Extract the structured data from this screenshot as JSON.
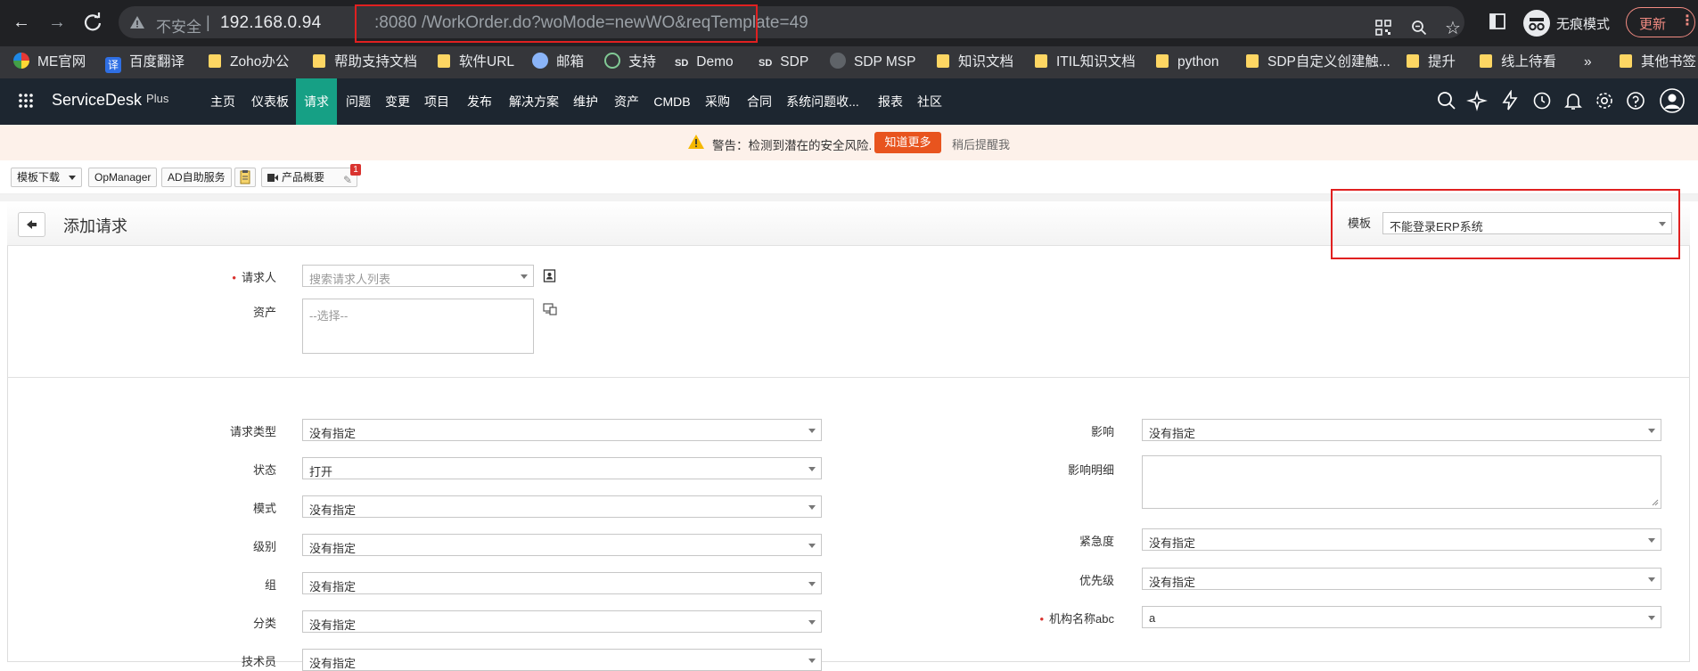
{
  "browser": {
    "insecure_label": "不安全",
    "separator": "|",
    "url_host": "192.168.0.94",
    "url_port": ":8080",
    "url_path": "/WorkOrder.do?woMode=newWO&reqTemplate=49",
    "incognito_label": "无痕模式",
    "update_label": "更新"
  },
  "bookmarks": [
    {
      "label": "ME官网",
      "icon": "me-logo-icon"
    },
    {
      "label": "百度翻译",
      "icon": "translate-icon"
    },
    {
      "label": "Zoho办公",
      "icon": "folder-icon"
    },
    {
      "label": "帮助支持文档",
      "icon": "folder-icon"
    },
    {
      "label": "软件URL",
      "icon": "folder-icon"
    },
    {
      "label": "邮箱",
      "icon": "mail-icon"
    },
    {
      "label": "支持",
      "icon": "support-icon"
    },
    {
      "label": "Demo",
      "icon": "sd-icon"
    },
    {
      "label": "SDP",
      "icon": "sd-icon"
    },
    {
      "label": "SDP MSP",
      "icon": "globe-icon"
    },
    {
      "label": "知识文档",
      "icon": "folder-icon"
    },
    {
      "label": "ITIL知识文档",
      "icon": "folder-icon"
    },
    {
      "label": "python",
      "icon": "folder-icon"
    },
    {
      "label": "SDP自定义创建触...",
      "icon": "folder-icon"
    },
    {
      "label": "提升",
      "icon": "folder-icon"
    },
    {
      "label": "线上待看",
      "icon": "folder-icon"
    }
  ],
  "bookmarks_more": "»",
  "bookmarks_other": "其他书签",
  "sd_badge": "SD",
  "app": {
    "brand": "ServiceDesk",
    "brand_plus": "Plus",
    "nav": [
      "主页",
      "仪表板",
      "请求",
      "问题",
      "变更",
      "项目",
      "发布",
      "解决方案",
      "维护",
      "资产",
      "CMDB",
      "采购",
      "合同",
      "系统问题收...",
      "报表",
      "社区"
    ],
    "active_nav": "请求"
  },
  "banner": {
    "warning_text": "警告：检测到潜在的安全风险.",
    "learn_more": "知道更多",
    "remind_later": "稍后提醒我"
  },
  "toolbar": {
    "template_download": "模板下载",
    "opmanager": "OpManager",
    "ad_self_service": "AD自助服务",
    "product_overview": "产品概要",
    "badge_count": "1"
  },
  "form": {
    "title": "添加请求",
    "template_label": "模板",
    "template_value": "不能登录ERP系统",
    "requester_label": "请求人",
    "requester_placeholder": "搜索请求人列表",
    "asset_label": "资产",
    "asset_placeholder": "--选择--",
    "left_fields": [
      {
        "label": "请求类型",
        "value": "没有指定"
      },
      {
        "label": "状态",
        "value": "打开"
      },
      {
        "label": "模式",
        "value": "没有指定"
      },
      {
        "label": "级别",
        "value": "没有指定"
      },
      {
        "label": "组",
        "value": "没有指定"
      },
      {
        "label": "分类",
        "value": "没有指定"
      },
      {
        "label": "技术员",
        "value": "没有指定"
      }
    ],
    "impact_label": "影响",
    "impact_value": "没有指定",
    "impact_detail_label": "影响明细",
    "urgency_label": "紧急度",
    "urgency_value": "没有指定",
    "priority_label": "优先级",
    "priority_value": "没有指定",
    "org_label": "机构名称abc",
    "org_value": "a"
  },
  "colors": {
    "url_highlight": "#e02020",
    "active_nav": "#16a085",
    "header_bg": "#1d2630",
    "banner_button": "#e8541e"
  }
}
